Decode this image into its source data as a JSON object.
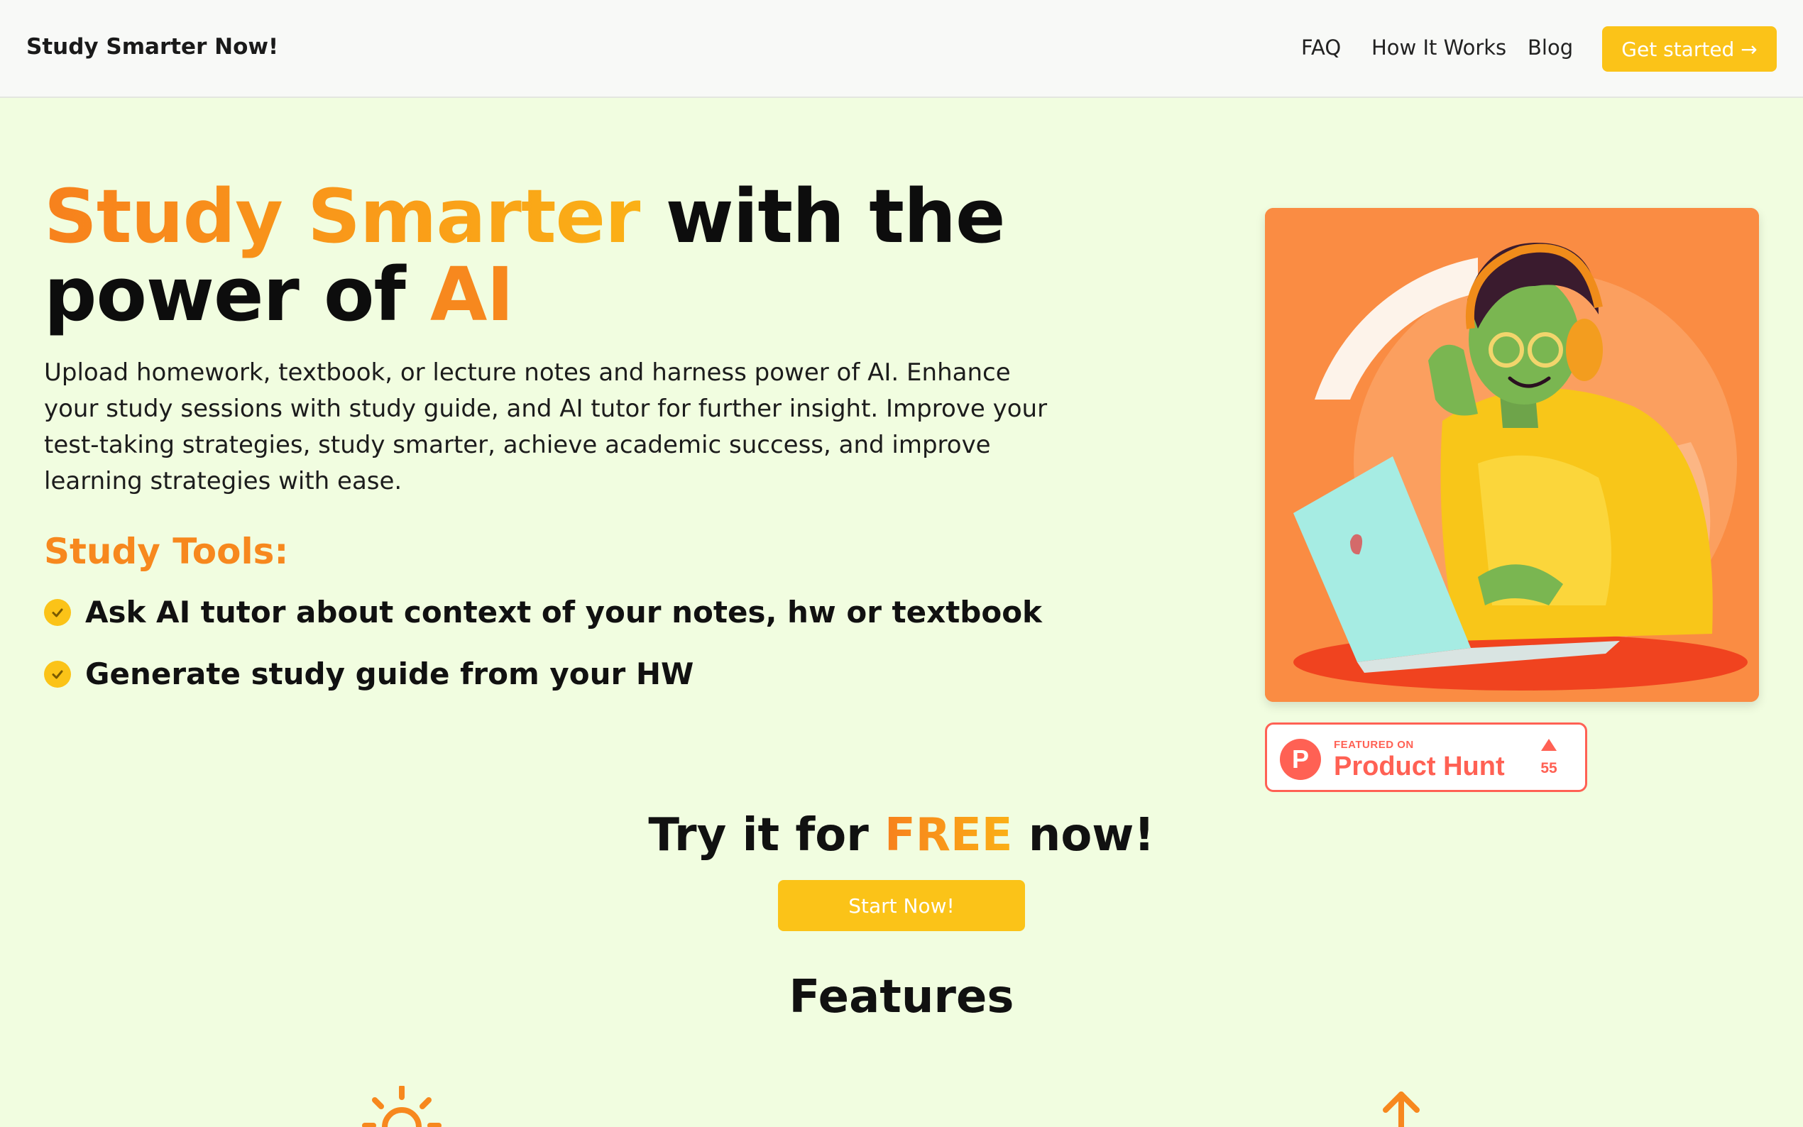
{
  "nav": {
    "brand": "Study Smarter Now!",
    "links": [
      {
        "label": "FAQ"
      },
      {
        "label": "How It Works"
      },
      {
        "label": "Blog"
      }
    ],
    "cta_label": "Get started →"
  },
  "hero": {
    "title_part1": "Study Smarter",
    "title_part2": " with the",
    "title_part3": "power of ",
    "title_part4": "AI",
    "description": "Upload homework, textbook, or lecture notes and harness power of AI. Enhance your study sessions with study guide, and AI tutor for further insight. Improve your test-taking strategies, study smarter, achieve academic success, and improve learning strategies with ease.",
    "tools_heading": "Study Tools:",
    "tools": [
      {
        "label": "Ask AI tutor about context of your notes, hw or textbook"
      },
      {
        "label": "Generate study guide from your HW"
      }
    ],
    "image_icon": "student-with-laptop-illustration"
  },
  "product_hunt": {
    "featured_label": "FEATURED ON",
    "name": "Product Hunt",
    "logo_letter": "P",
    "upvotes": "55"
  },
  "cta": {
    "heading_part1": "Try it for ",
    "heading_part2": "FREE",
    "heading_part3": " now!",
    "button_label": "Start Now!"
  },
  "features": {
    "heading": "Features",
    "icons": [
      "sun-icon",
      "arrow-up-icon"
    ]
  },
  "colors": {
    "accent_yellow": "#fbc318",
    "accent_orange": "#f7881e",
    "background": "#f1fde0",
    "product_hunt": "#ff6154"
  }
}
